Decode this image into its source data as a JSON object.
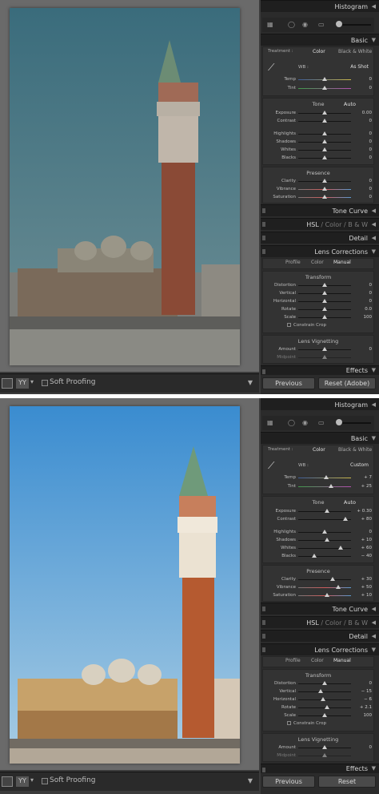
{
  "before": {
    "histogram_title": "Histogram",
    "basic_title": "Basic",
    "treatment_label": "Treatment :",
    "treatment_color": "Color",
    "treatment_bw": "Black & White",
    "wb_label": "WB :",
    "wb_value": "As Shot",
    "temp": {
      "label": "Temp",
      "value": "0",
      "pos": 0.5
    },
    "tint": {
      "label": "Tint",
      "value": "0",
      "pos": 0.5
    },
    "tone_title": "Tone",
    "auto_label": "Auto",
    "exposure": {
      "label": "Exposure",
      "value": "0.00",
      "pos": 0.5
    },
    "contrast": {
      "label": "Contrast",
      "value": "0",
      "pos": 0.5
    },
    "highlights": {
      "label": "Highlights",
      "value": "0",
      "pos": 0.5
    },
    "shadows": {
      "label": "Shadows",
      "value": "0",
      "pos": 0.5
    },
    "whites": {
      "label": "Whites",
      "value": "0",
      "pos": 0.5
    },
    "blacks": {
      "label": "Blacks",
      "value": "0",
      "pos": 0.5
    },
    "presence_title": "Presence",
    "clarity": {
      "label": "Clarity",
      "value": "0",
      "pos": 0.5
    },
    "vibrance": {
      "label": "Vibrance",
      "value": "0",
      "pos": 0.5
    },
    "saturation": {
      "label": "Saturation",
      "value": "0",
      "pos": 0.5
    },
    "tone_curve_title": "Tone Curve",
    "hsl_title": "HSL",
    "color_title": "Color",
    "bw_title": "B & W",
    "slash": "/",
    "detail_title": "Detail",
    "lens_title": "Lens Corrections",
    "profile_tab": "Profile",
    "color_tab": "Color",
    "manual_tab": "Manual",
    "transform_title": "Transform",
    "distortion": {
      "label": "Distortion",
      "value": "0",
      "pos": 0.5
    },
    "vertical": {
      "label": "Vertical",
      "value": "0",
      "pos": 0.5
    },
    "horizontal": {
      "label": "Horizontal",
      "value": "0",
      "pos": 0.5
    },
    "rotate": {
      "label": "Rotate",
      "value": "0.0",
      "pos": 0.5
    },
    "scale": {
      "label": "Scale",
      "value": "100",
      "pos": 0.5
    },
    "constrain_crop": "Constrain Crop",
    "vignetting_title": "Lens Vignetting",
    "amount": {
      "label": "Amount",
      "value": "0",
      "pos": 0.5
    },
    "midpoint": {
      "label": "Midpoint",
      "value": "",
      "pos": 0.5
    },
    "effects_title": "Effects",
    "previous_button": "Previous",
    "reset_button": "Reset (Adobe)",
    "soft_proofing": "Soft Proofing",
    "yy_label": "YY"
  },
  "after": {
    "histogram_title": "Histogram",
    "basic_title": "Basic",
    "treatment_label": "Treatment :",
    "treatment_color": "Color",
    "treatment_bw": "Black & White",
    "wb_label": "WB :",
    "wb_value": "Custom",
    "temp": {
      "label": "Temp",
      "value": "+ 7",
      "pos": 0.53
    },
    "tint": {
      "label": "Tint",
      "value": "+ 25",
      "pos": 0.62
    },
    "tone_title": "Tone",
    "auto_label": "Auto",
    "exposure": {
      "label": "Exposure",
      "value": "+ 0.30",
      "pos": 0.54
    },
    "contrast": {
      "label": "Contrast",
      "value": "+ 80",
      "pos": 0.9
    },
    "highlights": {
      "label": "Highlights",
      "value": "0",
      "pos": 0.5
    },
    "shadows": {
      "label": "Shadows",
      "value": "+ 10",
      "pos": 0.55
    },
    "whites": {
      "label": "Whites",
      "value": "+ 60",
      "pos": 0.8
    },
    "blacks": {
      "label": "Blacks",
      "value": "− 40",
      "pos": 0.3
    },
    "presence_title": "Presence",
    "clarity": {
      "label": "Clarity",
      "value": "+ 30",
      "pos": 0.65
    },
    "vibrance": {
      "label": "Vibrance",
      "value": "+ 50",
      "pos": 0.75
    },
    "saturation": {
      "label": "Saturation",
      "value": "+ 10",
      "pos": 0.55
    },
    "tone_curve_title": "Tone Curve",
    "hsl_title": "HSL",
    "color_title": "Color",
    "bw_title": "B & W",
    "slash": "/",
    "detail_title": "Detail",
    "lens_title": "Lens Corrections",
    "profile_tab": "Profile",
    "color_tab": "Color",
    "manual_tab": "Manual",
    "transform_title": "Transform",
    "distortion": {
      "label": "Distortion",
      "value": "0",
      "pos": 0.5
    },
    "vertical": {
      "label": "Vertical",
      "value": "− 15",
      "pos": 0.42
    },
    "horizontal": {
      "label": "Horizontal",
      "value": "− 6",
      "pos": 0.47
    },
    "rotate": {
      "label": "Rotate",
      "value": "+ 2.1",
      "pos": 0.55
    },
    "scale": {
      "label": "Scale",
      "value": "100",
      "pos": 0.5
    },
    "constrain_crop": "Constrain Crop",
    "vignetting_title": "Lens Vignetting",
    "amount": {
      "label": "Amount",
      "value": "0",
      "pos": 0.5
    },
    "midpoint": {
      "label": "Midpoint",
      "value": "",
      "pos": 0.5
    },
    "effects_title": "Effects",
    "previous_button": "Previous",
    "reset_button": "Reset",
    "soft_proofing": "Soft Proofing",
    "yy_label": "YY"
  },
  "colors": {
    "before_sky": "#3f6e7e",
    "after_sky": "#3f8fcf",
    "before_tower": "#8a4a36",
    "after_tower": "#b55a30",
    "panel_bg": "#2b2b2b"
  }
}
